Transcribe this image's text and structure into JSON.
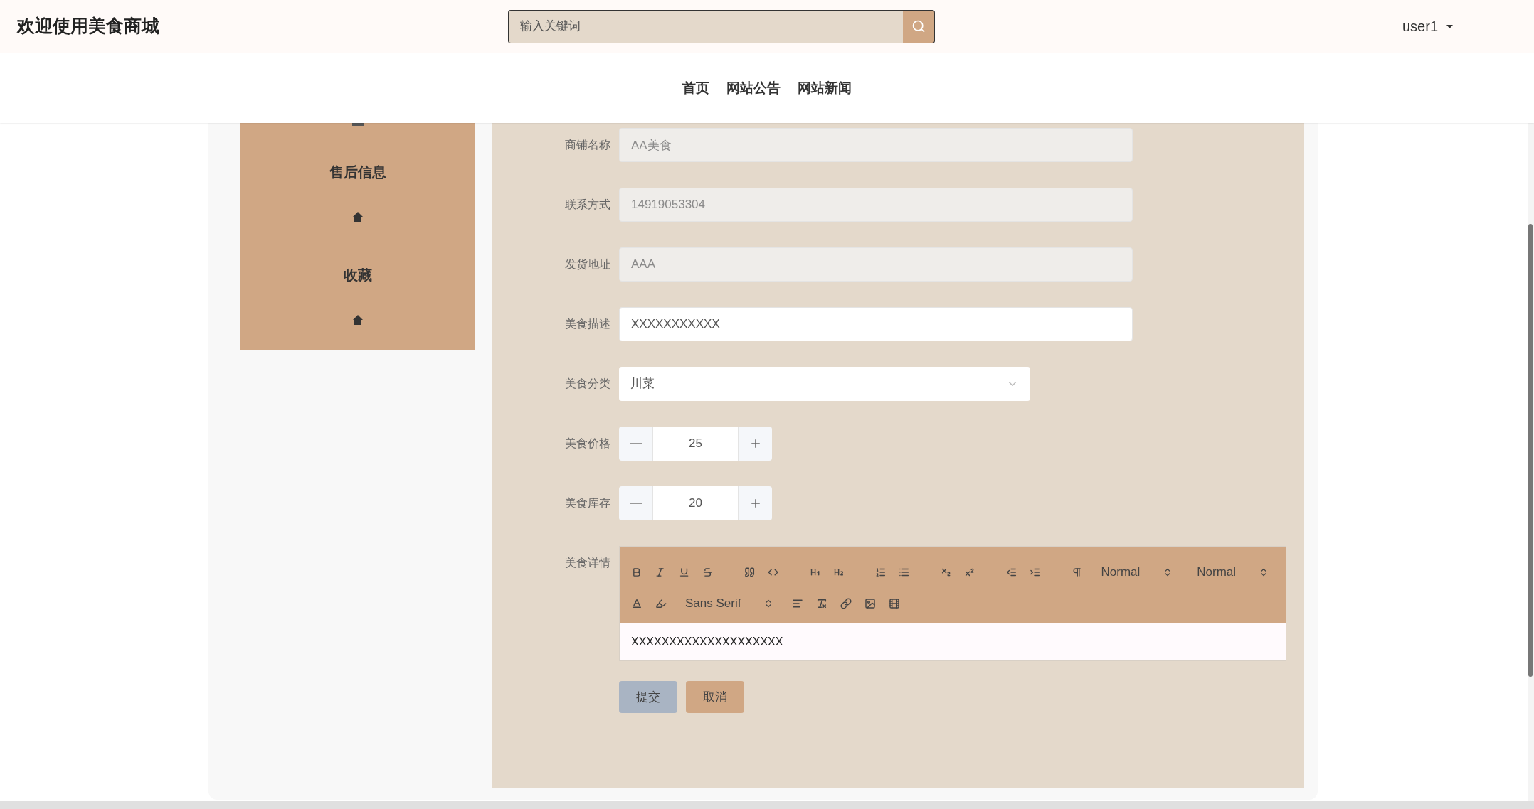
{
  "header": {
    "title": "欢迎使用美食商城",
    "search": {
      "placeholder": "输入关键词"
    },
    "user": "user1"
  },
  "nav": [
    {
      "label": "首页"
    },
    {
      "label": "网站公告"
    },
    {
      "label": "网站新闻"
    }
  ],
  "sidebar": {
    "items": [
      {
        "label": "售后信息"
      },
      {
        "label": "收藏"
      }
    ]
  },
  "form": {
    "fields": [
      {
        "kind": "text",
        "label": "商铺名称",
        "value": "AA美食",
        "disabled": true
      },
      {
        "kind": "text",
        "label": "联系方式",
        "value": "14919053304",
        "disabled": true
      },
      {
        "kind": "text",
        "label": "发货地址",
        "value": "AAA",
        "disabled": true
      },
      {
        "kind": "text",
        "label": "美食描述",
        "value": "XXXXXXXXXXX",
        "disabled": false
      },
      {
        "kind": "select",
        "label": "美食分类",
        "value": "川菜"
      },
      {
        "kind": "number",
        "label": "美食价格",
        "value": "25"
      },
      {
        "kind": "number",
        "label": "美食库存",
        "value": "20"
      },
      {
        "kind": "editor",
        "label": "美食详情",
        "value": "XXXXXXXXXXXXXXXXXXXX",
        "toolbar_selects": [
          "Normal",
          "Normal",
          "Sans Serif"
        ]
      }
    ],
    "buttons": [
      {
        "kind": "submit",
        "label": "提交"
      },
      {
        "kind": "cancel",
        "label": "取消"
      }
    ]
  }
}
